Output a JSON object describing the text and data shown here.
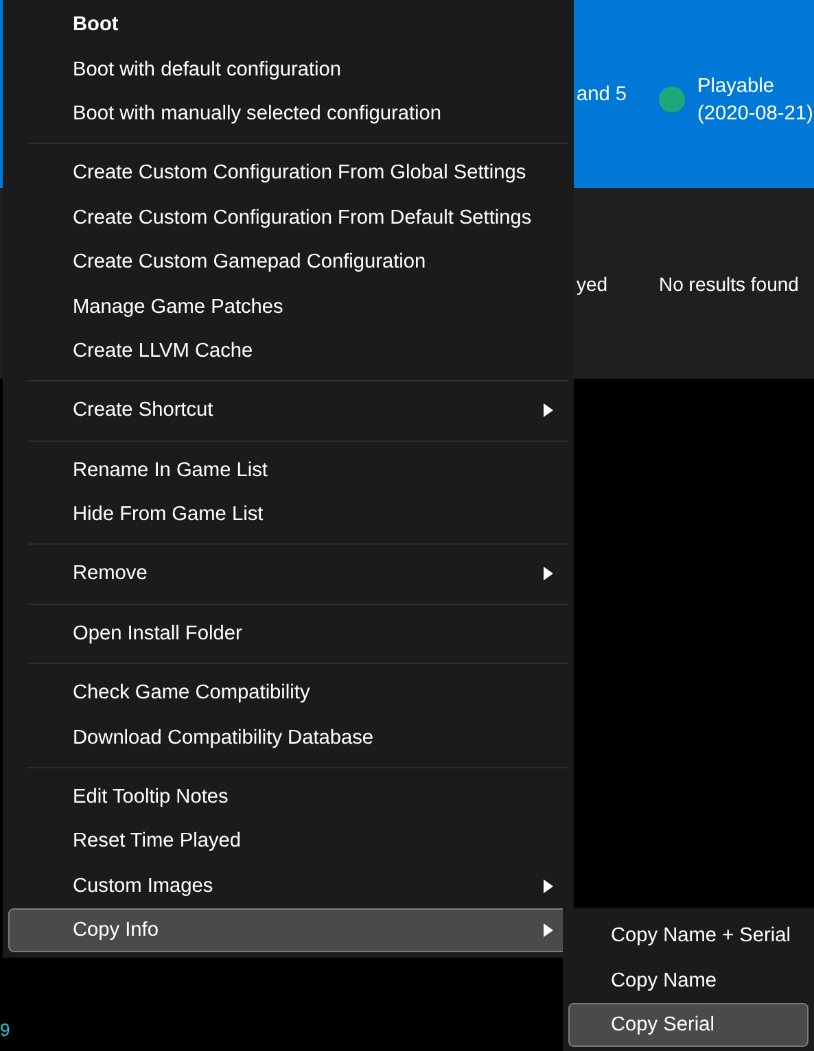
{
  "game_list": {
    "title_fragment": "and 5",
    "compatibility": {
      "status": "Playable",
      "date": "(2020-08-21)",
      "color": "#1ea77b"
    },
    "played_fragment": "yed",
    "patches_text": "No results found",
    "log_fragment": "9"
  },
  "context_menu": {
    "groups": [
      [
        {
          "label": "Boot",
          "bold": true,
          "submenu": false,
          "selected": false
        },
        {
          "label": "Boot with default configuration",
          "bold": false,
          "submenu": false,
          "selected": false
        },
        {
          "label": "Boot with manually selected configuration",
          "bold": false,
          "submenu": false,
          "selected": false
        }
      ],
      [
        {
          "label": "Create Custom Configuration From Global Settings",
          "bold": false,
          "submenu": false,
          "selected": false
        },
        {
          "label": "Create Custom Configuration From Default Settings",
          "bold": false,
          "submenu": false,
          "selected": false
        },
        {
          "label": "Create Custom Gamepad Configuration",
          "bold": false,
          "submenu": false,
          "selected": false
        },
        {
          "label": "Manage Game Patches",
          "bold": false,
          "submenu": false,
          "selected": false
        },
        {
          "label": "Create LLVM Cache",
          "bold": false,
          "submenu": false,
          "selected": false
        }
      ],
      [
        {
          "label": "Create Shortcut",
          "bold": false,
          "submenu": true,
          "selected": false
        }
      ],
      [
        {
          "label": "Rename In Game List",
          "bold": false,
          "submenu": false,
          "selected": false
        },
        {
          "label": "Hide From Game List",
          "bold": false,
          "submenu": false,
          "selected": false
        }
      ],
      [
        {
          "label": "Remove",
          "bold": false,
          "submenu": true,
          "selected": false
        }
      ],
      [
        {
          "label": "Open Install Folder",
          "bold": false,
          "submenu": false,
          "selected": false
        }
      ],
      [
        {
          "label": "Check Game Compatibility",
          "bold": false,
          "submenu": false,
          "selected": false
        },
        {
          "label": "Download Compatibility Database",
          "bold": false,
          "submenu": false,
          "selected": false
        }
      ],
      [
        {
          "label": "Edit Tooltip Notes",
          "bold": false,
          "submenu": false,
          "selected": false
        },
        {
          "label": "Reset Time Played",
          "bold": false,
          "submenu": false,
          "selected": false
        },
        {
          "label": "Custom Images",
          "bold": false,
          "submenu": true,
          "selected": false
        },
        {
          "label": "Copy Info",
          "bold": false,
          "submenu": true,
          "selected": true
        }
      ]
    ]
  },
  "submenu": {
    "items": [
      {
        "label": "Copy Name + Serial",
        "selected": false
      },
      {
        "label": "Copy Name",
        "selected": false
      },
      {
        "label": "Copy Serial",
        "selected": true
      }
    ]
  }
}
